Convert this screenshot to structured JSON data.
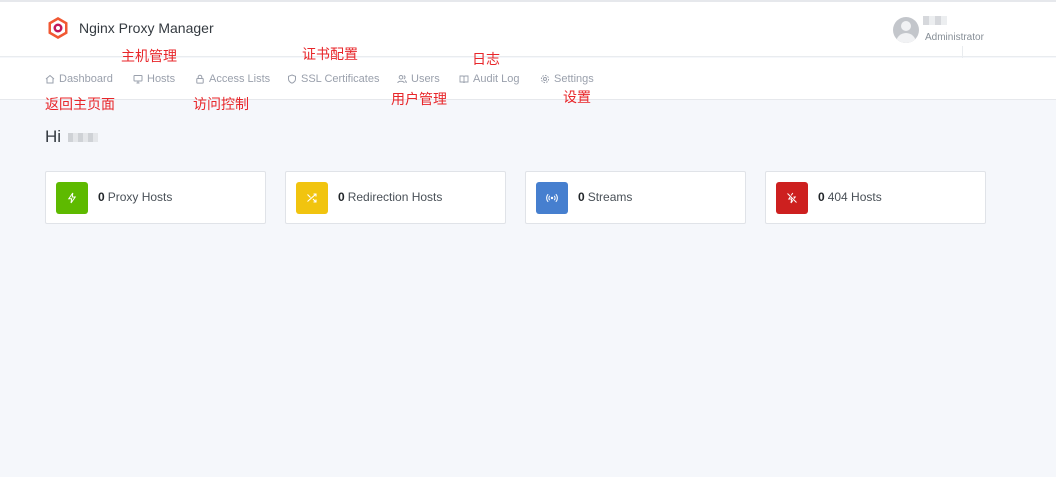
{
  "header": {
    "app_title": "Nginx Proxy Manager",
    "user_role": "Administrator"
  },
  "nav": [
    {
      "label": "Dashboard",
      "icon": "home-icon"
    },
    {
      "label": "Hosts",
      "icon": "monitor-icon"
    },
    {
      "label": "Access Lists",
      "icon": "lock-icon"
    },
    {
      "label": "SSL Certificates",
      "icon": "shield-icon"
    },
    {
      "label": "Users",
      "icon": "users-icon"
    },
    {
      "label": "Audit Log",
      "icon": "book-icon"
    },
    {
      "label": "Settings",
      "icon": "gear-icon"
    }
  ],
  "annotations": {
    "dashboard": "返回主页面",
    "hosts": "主机管理",
    "access_lists": "访问控制",
    "ssl": "证书配置",
    "users": "用户管理",
    "audit_log": "日志",
    "settings": "设置"
  },
  "greeting": "Hi",
  "cards": [
    {
      "count": "0",
      "label": "Proxy Hosts",
      "color": "#5eba00",
      "icon": "lightning-icon"
    },
    {
      "count": "0",
      "label": "Redirection Hosts",
      "color": "#f1c40f",
      "icon": "shuffle-icon"
    },
    {
      "count": "0",
      "label": "Streams",
      "color": "#467fcf",
      "icon": "radio-icon"
    },
    {
      "count": "0",
      "label": "404 Hosts",
      "color": "#cd201f",
      "icon": "zap-off-icon"
    }
  ]
}
